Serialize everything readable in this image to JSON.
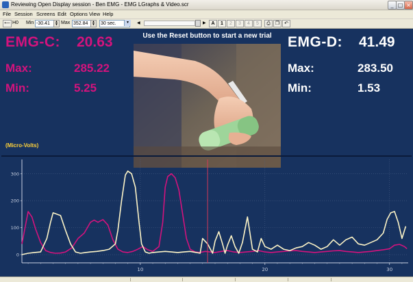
{
  "window": {
    "title": "Reviewing Open Display session - Ben EMG - EMG LGraphs & Video.scr",
    "controls": {
      "minimize": "_",
      "maximize": "□",
      "close": "×"
    }
  },
  "menu": {
    "items": [
      "File",
      "Session",
      "Screens",
      "Edit",
      "Options",
      "View",
      "Help"
    ]
  },
  "toolbar": {
    "step": "⟵",
    "step2": "⟶",
    "zoom_label": "H0",
    "min_label": "Min",
    "min_value": "-30.41",
    "max_label": "Max",
    "max_value": "352.84",
    "timespan_value": "30 sec.",
    "text_btn": "A",
    "page_buttons": [
      "1",
      "2",
      "3",
      "4",
      "5"
    ],
    "icons": [
      "print-icon",
      "copy-icon",
      "undo-icon"
    ]
  },
  "display": {
    "instruction": "Use the Reset button to start a new trial",
    "left": {
      "channel_label": "EMG-C:",
      "channel_value": "20.63",
      "max_label": "Max:",
      "max_value": "285.22",
      "min_label": "Min:",
      "min_value": "5.25",
      "color": "#d4137d"
    },
    "right": {
      "channel_label": "EMG-D:",
      "channel_value": "41.49",
      "max_label": "Max:",
      "max_value": "283.50",
      "min_label": "Min:",
      "min_value": "1.53",
      "color": "#ffffff"
    },
    "unit_label": "(Micro-Volts)"
  },
  "chart_data": {
    "type": "line",
    "title": "",
    "xlabel": "",
    "ylabel": "(Micro-Volts)",
    "xlim": [
      0.5,
      31.5
    ],
    "ylim": [
      -30.41,
      352.84
    ],
    "x_ticks": [
      10,
      20,
      30
    ],
    "y_ticks": [
      0,
      100,
      200,
      300
    ],
    "grid": true,
    "cursor_x": 15.4,
    "series": [
      {
        "name": "EMG-C",
        "color": "#d4137d",
        "x": [
          0.5,
          1.0,
          1.3,
          1.6,
          2.0,
          2.4,
          2.8,
          3.2,
          3.6,
          4.0,
          4.5,
          5.0,
          5.5,
          6.0,
          6.3,
          6.6,
          7.0,
          7.4,
          7.8,
          8.2,
          8.6,
          9.0,
          9.4,
          9.8,
          10.2,
          10.6,
          11.0,
          11.5,
          11.8,
          12.0,
          12.2,
          12.5,
          12.8,
          13.1,
          13.4,
          13.7,
          14.0,
          14.4,
          14.8,
          15.2,
          15.6,
          16.0,
          16.5,
          17.0,
          17.5,
          18.0,
          18.5,
          19.0,
          19.5,
          20.0,
          20.5,
          21.0,
          21.5,
          22.0,
          22.5,
          23.0,
          23.5,
          24.0,
          24.5,
          25.0,
          25.5,
          26.0,
          26.5,
          27.0,
          27.5,
          28.0,
          28.5,
          29.0,
          29.5,
          30.0,
          30.4,
          30.8,
          31.2,
          31.4
        ],
        "values": [
          40,
          160,
          140,
          95,
          45,
          15,
          8,
          5,
          6,
          10,
          25,
          60,
          80,
          120,
          128,
          120,
          130,
          110,
          55,
          20,
          10,
          8,
          12,
          20,
          30,
          18,
          12,
          30,
          120,
          250,
          290,
          300,
          285,
          240,
          150,
          60,
          20,
          10,
          8,
          12,
          10,
          8,
          12,
          15,
          10,
          8,
          10,
          12,
          15,
          10,
          8,
          10,
          12,
          14,
          15,
          12,
          10,
          8,
          10,
          12,
          14,
          15,
          12,
          10,
          8,
          10,
          12,
          15,
          18,
          22,
          35,
          38,
          30,
          22
        ]
      },
      {
        "name": "EMG-D",
        "color": "#fff6c8",
        "x": [
          0.5,
          1.0,
          1.5,
          2.0,
          2.5,
          2.8,
          3.0,
          3.3,
          3.6,
          4.0,
          4.4,
          4.8,
          5.2,
          5.6,
          6.0,
          6.5,
          7.0,
          7.5,
          8.0,
          8.2,
          8.5,
          8.8,
          9.0,
          9.3,
          9.6,
          9.9,
          10.1,
          10.4,
          10.7,
          11.0,
          11.5,
          12.0,
          12.5,
          13.0,
          13.5,
          14.0,
          14.5,
          14.8,
          15.0,
          15.4,
          15.8,
          16.0,
          16.3,
          16.6,
          16.8,
          17.0,
          17.3,
          17.6,
          17.9,
          18.2,
          18.6,
          19.0,
          19.4,
          19.7,
          20.0,
          20.5,
          21.0,
          21.5,
          22.0,
          22.5,
          23.0,
          23.5,
          24.0,
          24.5,
          25.0,
          25.5,
          26.0,
          26.5,
          27.0,
          27.5,
          28.0,
          28.5,
          29.0,
          29.5,
          29.8,
          30.1,
          30.4,
          30.7,
          31.0,
          31.3
        ],
        "values": [
          0,
          5,
          8,
          10,
          60,
          120,
          155,
          150,
          145,
          90,
          40,
          10,
          5,
          8,
          10,
          12,
          15,
          20,
          40,
          90,
          200,
          295,
          310,
          300,
          250,
          120,
          40,
          10,
          5,
          8,
          10,
          12,
          10,
          8,
          10,
          12,
          8,
          5,
          60,
          40,
          5,
          50,
          85,
          40,
          5,
          35,
          70,
          30,
          5,
          45,
          140,
          20,
          10,
          60,
          30,
          20,
          35,
          20,
          15,
          25,
          30,
          45,
          35,
          20,
          30,
          55,
          35,
          55,
          65,
          40,
          35,
          45,
          55,
          80,
          130,
          155,
          160,
          120,
          60,
          105
        ]
      }
    ]
  },
  "status": {}
}
